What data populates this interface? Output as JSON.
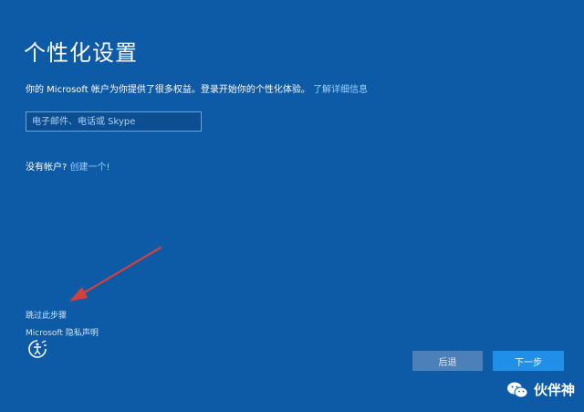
{
  "header": {
    "title": "个性化设置"
  },
  "intro": {
    "text": "你的 Microsoft 帐户为你提供了很多权益。登录开始你的个性化体验。",
    "learn_more": "了解详细信息"
  },
  "signin": {
    "placeholder": "电子邮件、电话或 Skype"
  },
  "no_account": {
    "text": "没有帐户?",
    "create_link": "创建一个!"
  },
  "footer": {
    "skip": "跳过此步骤",
    "privacy": "Microsoft 隐私声明",
    "accessibility_icon": "ease-of-access-icon"
  },
  "buttons": {
    "back": "后退",
    "next": "下一步"
  },
  "watermark": {
    "icon": "wechat-icon",
    "text": "伙伴神"
  },
  "colors": {
    "background": "#0d5aa6",
    "link": "#9fd0ff",
    "next_button": "#1f8fe8",
    "back_button": "#4c80b8",
    "annotation_arrow": "#d6403a"
  }
}
